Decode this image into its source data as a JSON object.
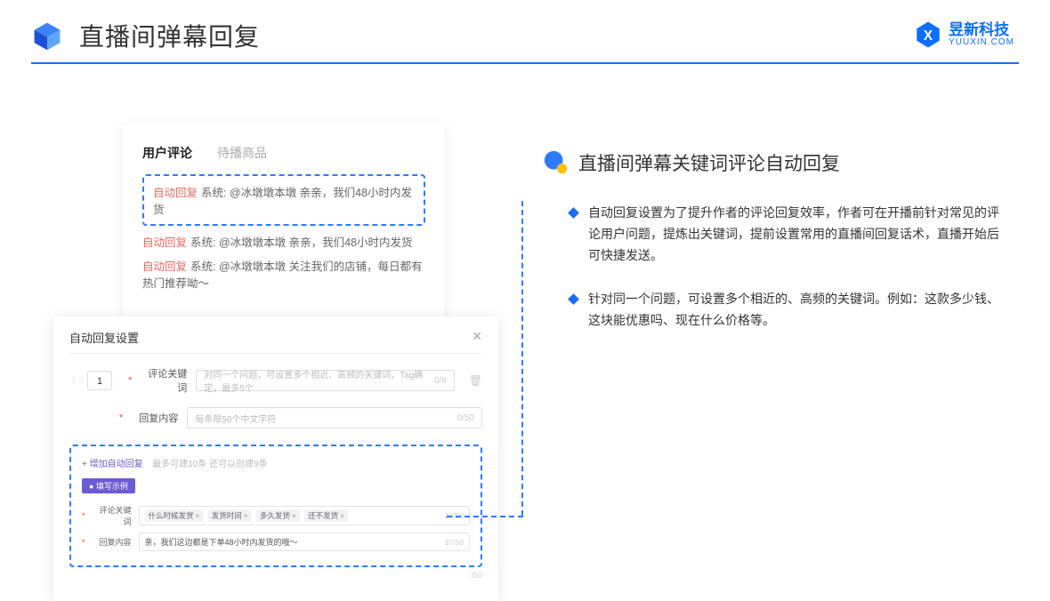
{
  "header": {
    "title": "直播间弹幕回复"
  },
  "brand": {
    "name": "昱新科技",
    "url": "YUUXIN.COM"
  },
  "cardTop": {
    "tabActive": "用户评论",
    "tabInactive": "待播商品",
    "highlight": {
      "tag": "自动回复",
      "text": "系统: @冰墩墩本墩 亲亲，我们48小时内发货"
    },
    "row2": {
      "tag": "自动回复",
      "text": "系统: @冰墩墩本墩 亲亲，我们48小时内发货"
    },
    "row3": {
      "tag": "自动回复",
      "text": "系统: @冰墩墩本墩 关注我们的店铺，每日都有热门推荐呦～"
    }
  },
  "modal": {
    "title": "自动回复设置",
    "num": "1",
    "label1": "评论关键词",
    "ph1": "对同一个问题，可设置多个相近、高频的关键词，Tag确定，最多5个",
    "cnt1": "0/8",
    "label2": "回复内容",
    "ph2": "每条限50个中文字符",
    "cnt2": "0/50",
    "addLink": "+ 增加自动回复",
    "addHint": "最多可建10条 还可以创建9条",
    "pill": "● 填写示例",
    "exLabel1": "评论关键词",
    "tags": [
      "什么时候发货",
      "发货时间",
      "多久发货",
      "还不发货"
    ],
    "exCnt1": "20/50",
    "exLabel2": "回复内容",
    "exVal2": "亲，我们这边都是下单48小时内发货的哦～",
    "exCnt2": "37/50",
    "subCnt": "/50"
  },
  "right": {
    "title": "直播间弹幕关键词评论自动回复",
    "b1": "自动回复设置为了提升作者的评论回复效率，作者可在开播前针对常见的评论用户问题，提炼出关键词，提前设置常用的直播间回复话术，直播开始后可快捷发送。",
    "b2": "针对同一个问题，可设置多个相近的、高频的关键词。例如：这款多少钱、这块能优惠吗、现在什么价格等。"
  }
}
